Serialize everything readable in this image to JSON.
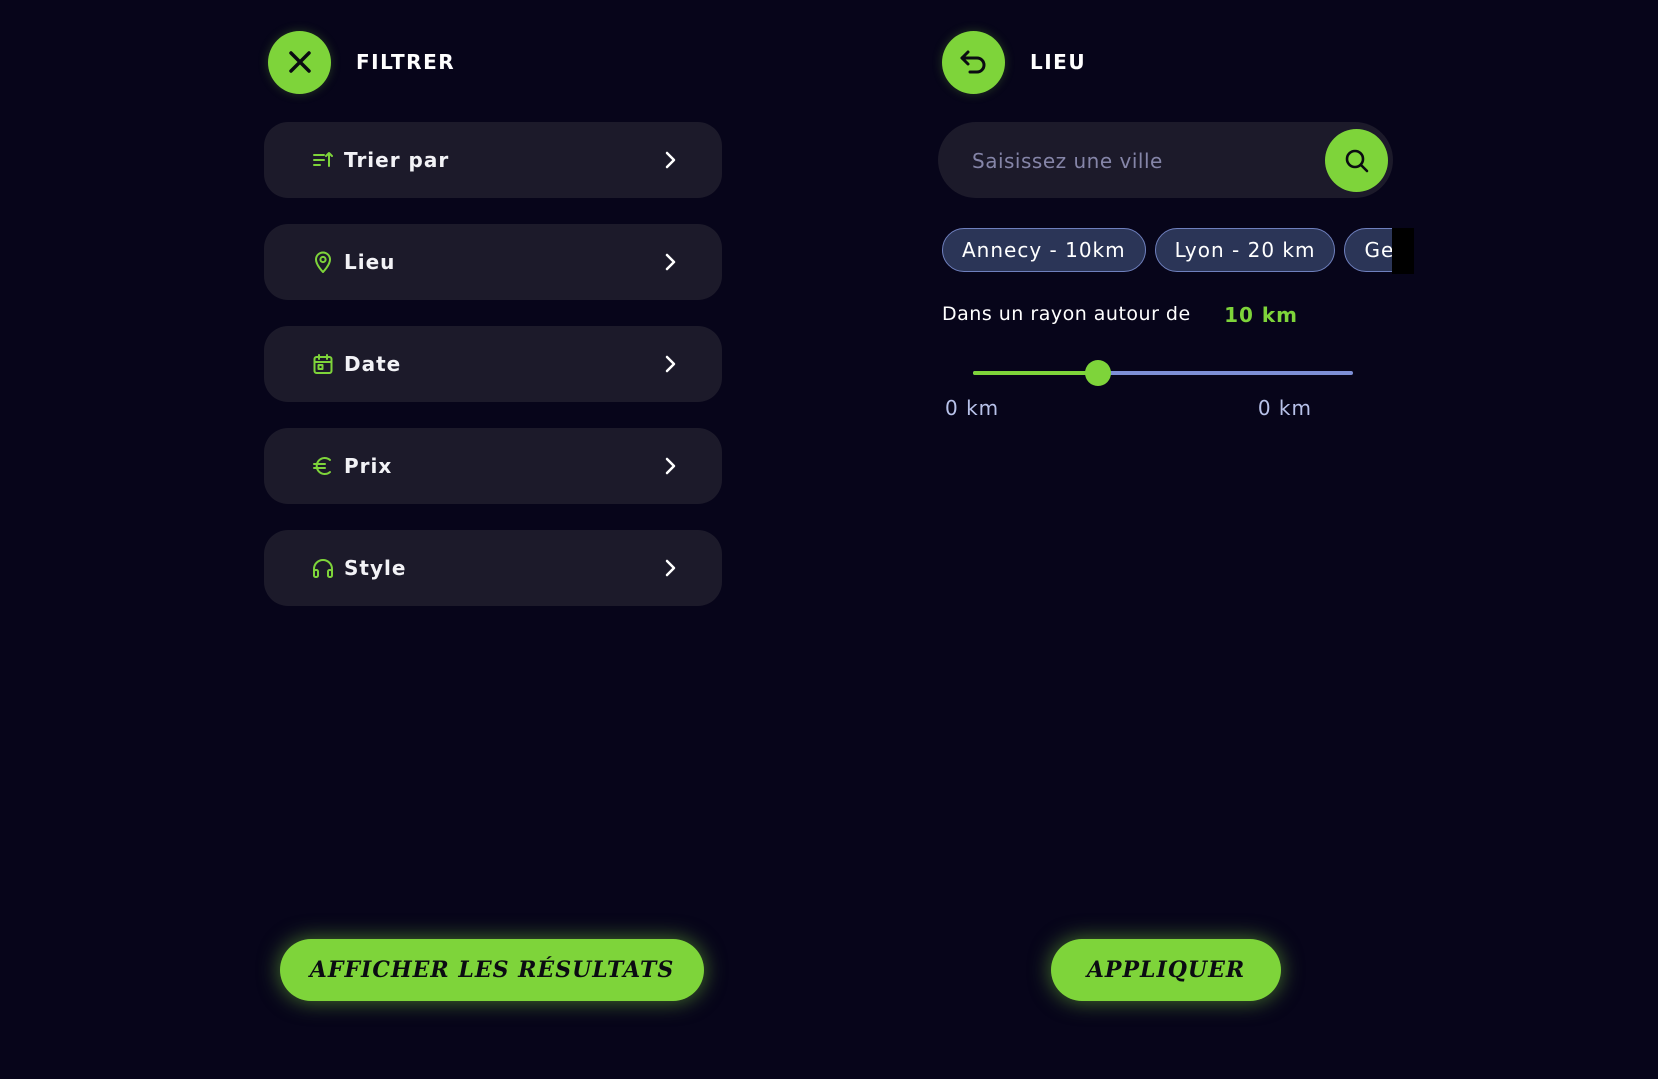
{
  "filter_panel": {
    "title": "FILTRER",
    "close_icon": "close-icon",
    "items": [
      {
        "label": "Trier par",
        "icon": "sort-icon"
      },
      {
        "label": "Lieu",
        "icon": "location-pin-icon"
      },
      {
        "label": "Date",
        "icon": "calendar-icon"
      },
      {
        "label": "Prix",
        "icon": "euro-icon"
      },
      {
        "label": "Style",
        "icon": "headphones-icon"
      }
    ],
    "results_button": "AFFICHER LES RÉSULTATS"
  },
  "location_panel": {
    "title": "LIEU",
    "back_icon": "back-arrow-icon",
    "search": {
      "placeholder": "Saisissez une ville",
      "value": ""
    },
    "chips": [
      "Annecy - 10km",
      "Lyon - 20 km",
      "Ge"
    ],
    "radius_label": "Dans un rayon autour de",
    "radius_value": "10 km",
    "slider": {
      "min_label": "0 km",
      "max_label": "0 km",
      "fraction": 0.33
    },
    "apply_button": "APPLIQUER"
  },
  "colors": {
    "background": "#07051a",
    "card": "#1c1a2a",
    "accent": "#7ed43a",
    "chip_fill": "#2b3557",
    "chip_border": "#6f80be",
    "slider_track": "#7d8fd6"
  }
}
